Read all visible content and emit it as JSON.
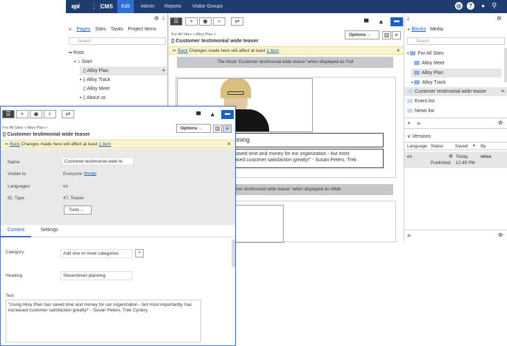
{
  "topnav": {
    "logo": "epi",
    "product": "CMS",
    "tabs": [
      "Edit",
      "Admin",
      "Reports",
      "Visitor Groups"
    ]
  },
  "left_panel": {
    "tabs": [
      "Pages",
      "Sites",
      "Tasks",
      "Project Items"
    ],
    "search_placeholder": "Search",
    "tree": [
      "Root",
      "Start",
      "Alloy Plan",
      "Alloy Track",
      "Alloy Meet",
      "About us"
    ]
  },
  "middle_panel": {
    "breadcrumb": "For All Sites  >  Alloy Plan  >",
    "title": "Customer testimonial wide teaser",
    "options_label": "Options",
    "notice": {
      "back": "Back",
      "text": "Changes made here will affect at least",
      "link": "1 item"
    },
    "full_band": "The block 'Customer testimonial wide teaser' when displayed as Full",
    "heading_fragment": "nning",
    "quote_line1": "saved time and money for our organization - but most",
    "quote_line2": "ased customer satisfaction greatly!\" - Susan Peters, Trek",
    "wide_band": "stomer testimonial wide teaser' when displayed as Wide"
  },
  "right_panel": {
    "tabs": [
      "Blocks",
      "Media"
    ],
    "search_placeholder": "Search",
    "tree": [
      "For All Sites",
      "Alloy Meet",
      "Alloy Plan",
      "Alloy Track"
    ],
    "items": [
      "Customer testimonial wide teaser",
      "Event list",
      "News list"
    ],
    "versions": {
      "title": "Versions",
      "columns": [
        "Language",
        "Status",
        "Saved",
        "By"
      ],
      "row": {
        "language": "en",
        "status": "Published",
        "saved_day": "Today,",
        "saved_time": "12:49 PM",
        "by": "misu"
      }
    }
  },
  "front_panel": {
    "breadcrumb": "For All Sites  >  Alloy Plan  >",
    "title": "Customer testimonial wide teaser",
    "options_label": "Options",
    "notice": {
      "back": "Back",
      "text": "Changes made here will affect at least",
      "link": "1 item"
    },
    "properties": {
      "name_label": "Name",
      "name_value": "Customer testimonial wide te:",
      "visible_label": "Visible to",
      "visible_value": "Everyone",
      "visible_link": "Manage",
      "lang_label": "Languages",
      "lang_value": "en",
      "id_label": "ID, Type",
      "id_value": "47, Teaser",
      "tools": "Tools"
    },
    "tabs": [
      "Content",
      "Settings"
    ],
    "category_label": "Category",
    "category_value": "Add one or more categories",
    "heading_label": "Heading",
    "heading_value": "Streamlined planning",
    "text_label": "Text",
    "text_value": "\"Using Alloy Plan has saved time and money for our organization - but most importantly, has increased customer satisfaction greatly!\" - Susan Peters, Trek Cyclery"
  }
}
